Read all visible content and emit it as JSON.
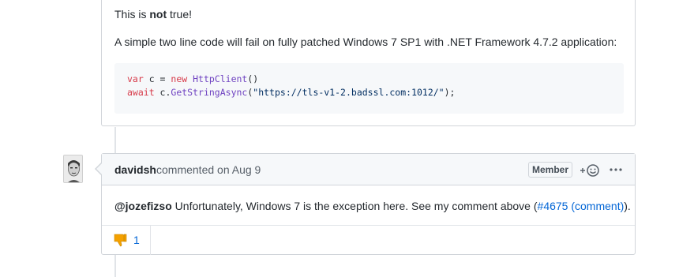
{
  "comment1": {
    "line1_prefix": "This is ",
    "line1_bold": "not",
    "line1_suffix": " true!",
    "line2": "A simple two line code will fail on fully patched Windows 7 SP1 with .NET Framework 4.7.2 application:",
    "code": {
      "l1_kw1": "var",
      "l1_mid": " c = ",
      "l1_kw2": "new",
      "l1_sp": " ",
      "l1_fn": "HttpClient",
      "l1_end": "()",
      "l2_kw": "await",
      "l2_mid": " c.",
      "l2_fn": "GetStringAsync",
      "l2_open": "(",
      "l2_str": "\"https://tls-v1-2.badssl.com:1012/\"",
      "l2_end": ");"
    }
  },
  "comment2": {
    "author": "davidsh",
    "action": "commented on",
    "date": "Aug 9",
    "badge": "Member",
    "mention": "@jozefizso",
    "body_text": " Unfortunately, Windows 7 is the exception here. See my comment above (",
    "link1": "#4675",
    "link_space": " ",
    "link2": "(comment)",
    "body_end": ").",
    "reaction": {
      "icon": "thumbs-down-icon",
      "count": "1",
      "color": "#f4a100"
    }
  },
  "colors": {
    "link": "#0366d6",
    "border": "#d1d5da",
    "header_bg": "#f6f8fa"
  }
}
